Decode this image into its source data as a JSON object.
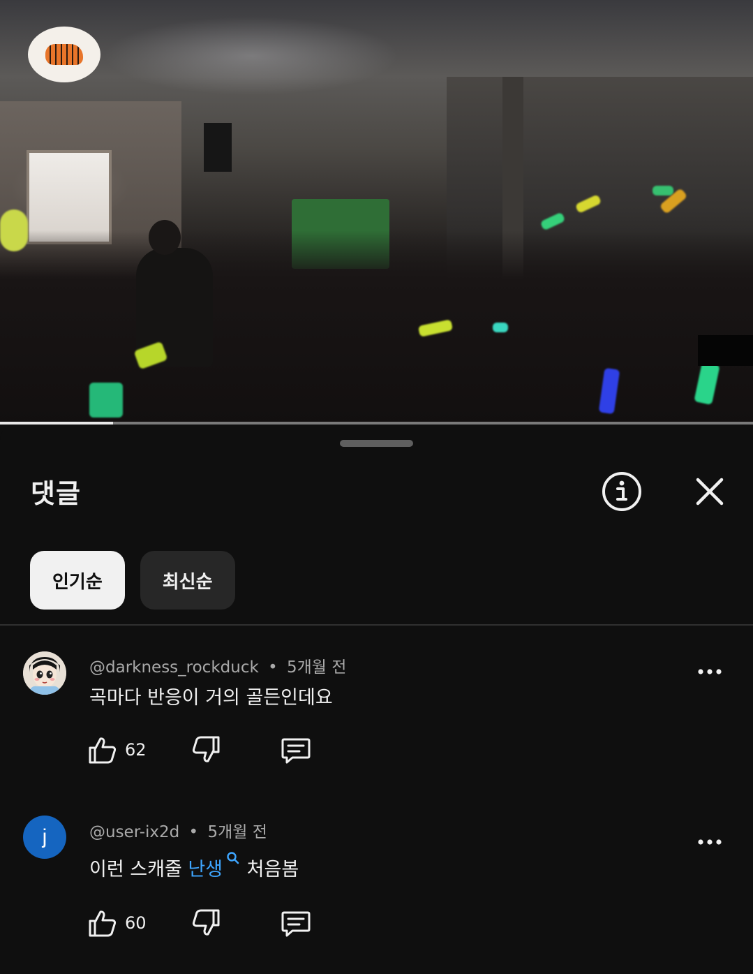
{
  "video": {
    "logo_icon": "channel-logo-tiger",
    "progress_percent": 15
  },
  "sheet": {
    "title": "댓글",
    "info_icon": "info-icon",
    "close_icon": "close-icon",
    "sort_chips": [
      {
        "label": "인기순",
        "selected": true
      },
      {
        "label": "최신순",
        "selected": false
      }
    ]
  },
  "comments": [
    {
      "handle": "@darkness_rockduck",
      "separator": "•",
      "time": "5개월 전",
      "text_before": "곡마다 반응이 거의 골든인데요",
      "link_text": "",
      "text_after": "",
      "likes": "62",
      "avatar": "cartoon-girl-avatar"
    },
    {
      "handle": "@user-ix2d",
      "separator": "•",
      "time": "5개월 전",
      "text_before": "이런 스캐줄 ",
      "link_text": "난생",
      "text_after": " 처음봄",
      "likes": "60",
      "avatar_letter": "j",
      "avatar_color": "#1565c0"
    }
  ],
  "colors": {
    "background": "#0f0f0f",
    "link": "#3ea6ff",
    "chip_active": "#f1f1f1",
    "chip_inactive": "#272727"
  }
}
